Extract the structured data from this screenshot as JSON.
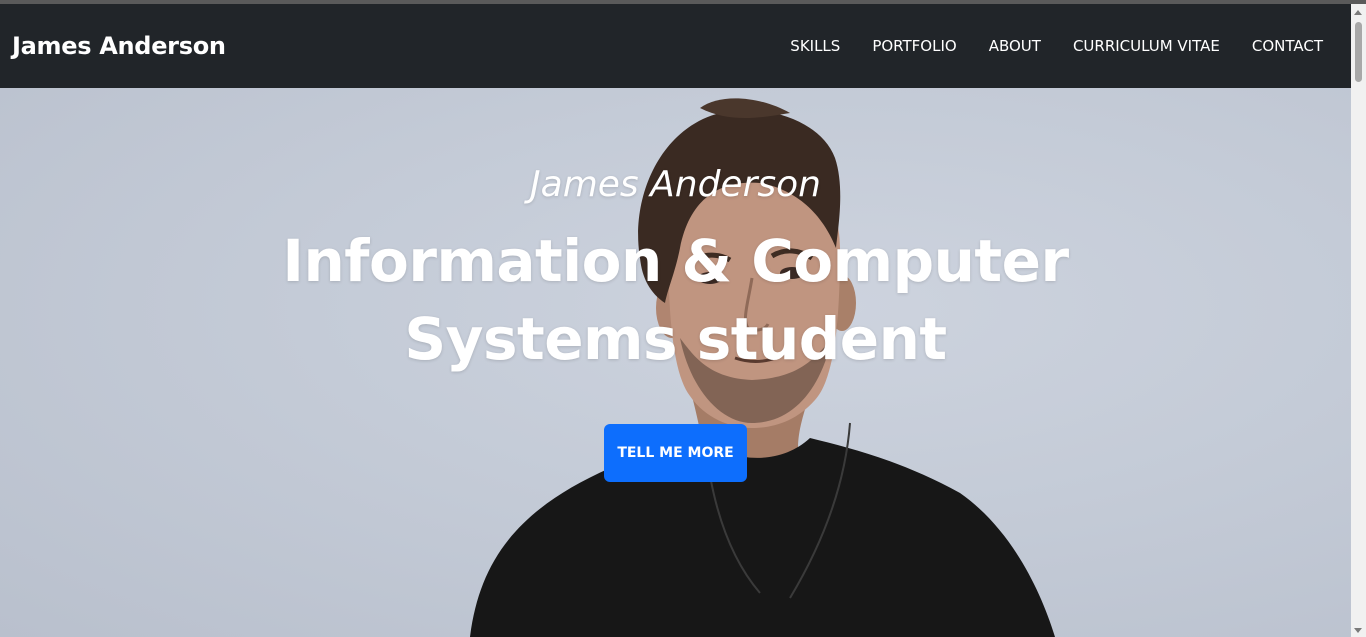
{
  "navbar": {
    "brand": "James Anderson",
    "links": [
      "SKILLS",
      "PORTFOLIO",
      "ABOUT",
      "CURRICULUM VITAE",
      "CONTACT"
    ]
  },
  "hero": {
    "subtitle": "James Anderson",
    "headline": "Information & Computer Systems student",
    "cta_label": "TELL ME MORE",
    "photo": "portrait-photo"
  },
  "colors": {
    "navbar_bg": "#212529",
    "cta_bg": "#0d6efd",
    "hero_bg": "#c8cfda",
    "text": "#ffffff"
  }
}
